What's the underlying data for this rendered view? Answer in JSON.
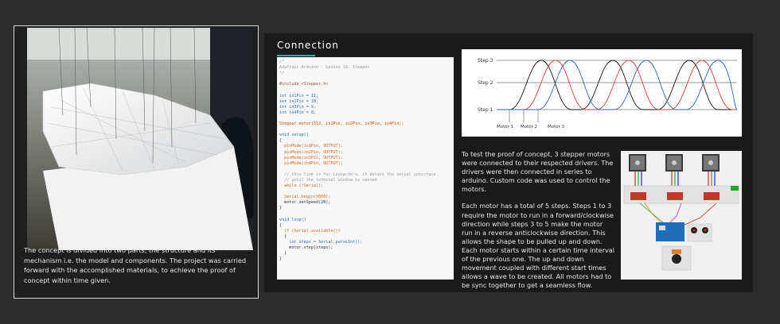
{
  "left_panel": {
    "description": "The concept is divided into two parts, the structure and its mechanism i.e. the model and components. The project was carried forward with the accomplished materials, to achieve the proof of concept within time given."
  },
  "connection": {
    "heading": "Connection",
    "accent_color": "#1fb5a0"
  },
  "code_lines": [
    {
      "t": "/*",
      "cls": "c"
    },
    {
      "t": "Adafruit Arduino - Lesson 16. Stepper",
      "cls": "c"
    },
    {
      "t": "*/",
      "cls": "c"
    },
    {
      "t": "",
      "cls": ""
    },
    {
      "t": "#include <Stepper.h>",
      "cls": "d"
    },
    {
      "t": "",
      "cls": ""
    },
    {
      "t": "int in1Pin = 11;",
      "cls": "k"
    },
    {
      "t": "int in2Pin = 10;",
      "cls": "k"
    },
    {
      "t": "int in3Pin = 9;",
      "cls": "k"
    },
    {
      "t": "int in4Pin = 8;",
      "cls": "k"
    },
    {
      "t": "",
      "cls": ""
    },
    {
      "t": "Stepper motor(512, in1Pin, in2Pin, in3Pin, in4Pin);",
      "cls": "s"
    },
    {
      "t": "",
      "cls": ""
    },
    {
      "t": "void setup()",
      "cls": "k"
    },
    {
      "t": "{",
      "cls": ""
    },
    {
      "t": "  pinMode(in1Pin, OUTPUT);",
      "cls": "f"
    },
    {
      "t": "  pinMode(in2Pin, OUTPUT);",
      "cls": "f"
    },
    {
      "t": "  pinMode(in3Pin, OUTPUT);",
      "cls": "f"
    },
    {
      "t": "  pinMode(in4Pin, OUTPUT);",
      "cls": "f"
    },
    {
      "t": "",
      "cls": ""
    },
    {
      "t": "  // this line is for Leonardo's, it delays the serial interface",
      "cls": "c"
    },
    {
      "t": "  // until the terminal window is opened",
      "cls": "c"
    },
    {
      "t": "  while (!Serial);",
      "cls": "f"
    },
    {
      "t": "",
      "cls": ""
    },
    {
      "t": "  Serial.begin(9600);",
      "cls": "f"
    },
    {
      "t": "  motor.setSpeed(20);",
      "cls": ""
    },
    {
      "t": "}",
      "cls": ""
    },
    {
      "t": "",
      "cls": ""
    },
    {
      "t": "void loop()",
      "cls": "k"
    },
    {
      "t": "{",
      "cls": ""
    },
    {
      "t": "  if (Serial.available())",
      "cls": "f"
    },
    {
      "t": "  {",
      "cls": ""
    },
    {
      "t": "    int steps = Serial.parseInt();",
      "cls": "k"
    },
    {
      "t": "    motor.step(steps);",
      "cls": ""
    },
    {
      "t": "  }",
      "cls": ""
    },
    {
      "t": "}",
      "cls": ""
    }
  ],
  "wave_diagram": {
    "step_labels": [
      "Step 3",
      "Step 2",
      "Step 1"
    ],
    "motor_labels": [
      "Motor 1",
      "Motor 2",
      "Motor 3"
    ],
    "colors": {
      "motor1": "#111111",
      "motor2": "#d83a3a",
      "motor3": "#2f5fb8"
    }
  },
  "right_text": {
    "p1": "To test the proof of concept, 3 stepper motors were connected to their respected drivers. The drivers were then connected in series to arduino. Custom code was used to control the motors.",
    "p2": "Each motor has a total of 5 steps. Steps 1 to 3 require the motor to run in a forward/clockwise direction while steps 3 to 5 make the motor run in a reverse anticlockwise direction. This allows the shape to be pulled up and down. Each motor starts within a certain time interval of the previous one. The up and down movement coupled with different start times allows a wave to be created. All motors had to be sync together to get a seamless flow."
  }
}
